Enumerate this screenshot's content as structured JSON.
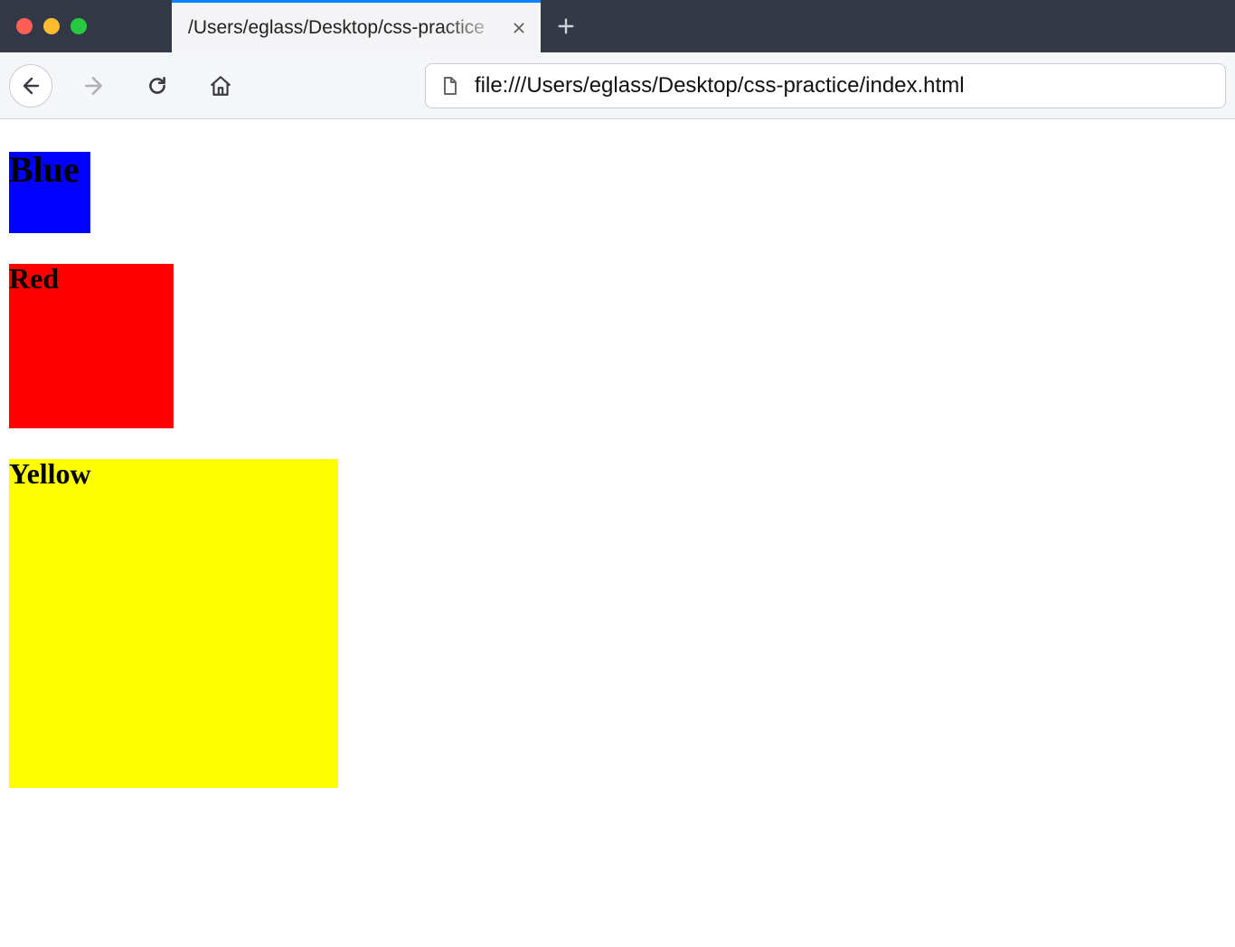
{
  "window": {
    "tab_title": "/Users/eglass/Desktop/css-practice",
    "url": "file:///Users/eglass/Desktop/css-practice/index.html"
  },
  "page": {
    "boxes": [
      {
        "label": "Blue",
        "color": "#0000ff",
        "size": 90
      },
      {
        "label": "Red",
        "color": "#ff0000",
        "size": 182
      },
      {
        "label": "Yellow",
        "color": "#ffff00",
        "size": 364
      }
    ]
  }
}
